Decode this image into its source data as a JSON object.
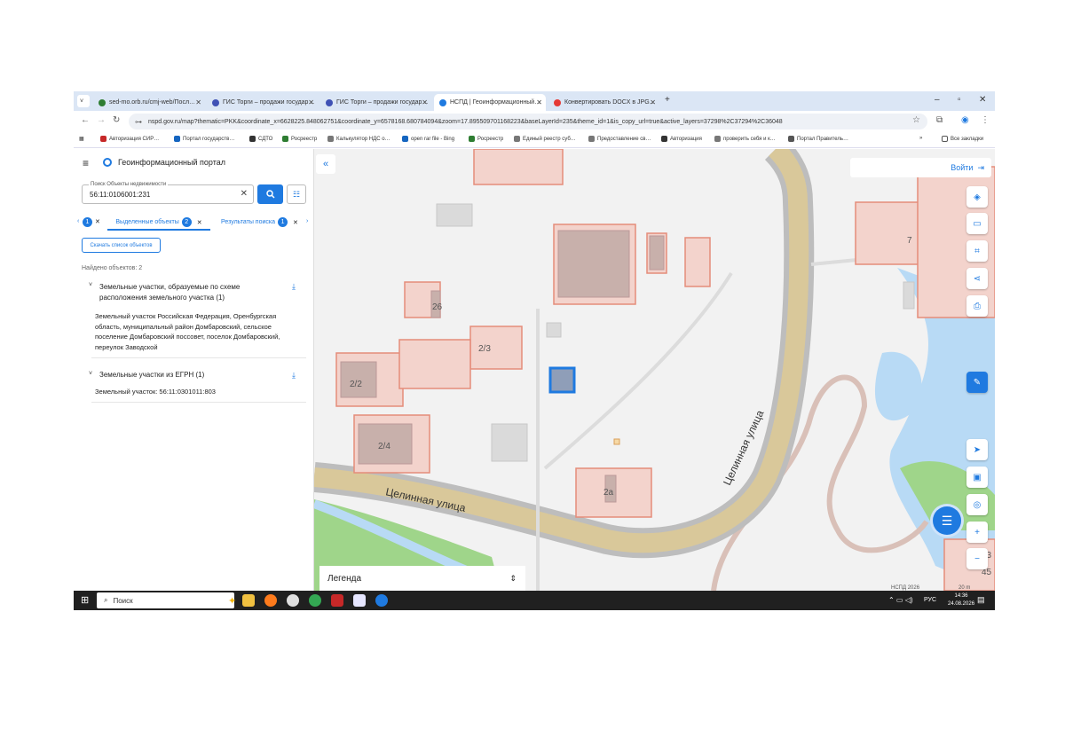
{
  "tabs": [
    {
      "label": "sed-mo.orb.ru/cmj-web/Посл…",
      "active": false
    },
    {
      "label": "ГИС Торги – продажи государ…",
      "active": false
    },
    {
      "label": "ГИС Торги – продажи государ…",
      "active": false
    },
    {
      "label": "НСПД | Геоинформационный…",
      "active": true
    },
    {
      "label": "Конвертировать DOCX в JPG…",
      "active": false
    }
  ],
  "address": {
    "url": "nspd.gov.ru/map?thematic=PKK&coordinate_x=6628225.848062751&coordinate_y=6578168.680784094&zoom=17.895509701168223&baseLayerId=235&theme_id=1&is_copy_url=true&active_layers=37298%2C37294%2C36048"
  },
  "bookmarks": [
    "Авторизация СИР…",
    "Портал государств…",
    "СДТО",
    "Росреестр",
    "Калькулятор НДС о…",
    "open rar file - Bing",
    "Росреестр",
    "Единый реестр суб…",
    "Предоставление св…",
    "Авторизация",
    "проверить себя и к…",
    "Портал Правитель…"
  ],
  "bookmarks_all": "Все закладки",
  "portal": {
    "title": "Геоинформационный портал",
    "search_label": "Поиск Объекты недвижимости",
    "search_value": "56:11:0106001:231",
    "tab_selected_label": "Выделенные объекты",
    "tab_selected_count": "2",
    "tab_results_label": "Результаты поиска",
    "tab_results_count": "1",
    "tab_prev_count": "1",
    "download_label": "Скачать список объектов",
    "found_label": "Найдено объектов: 2",
    "group1_title": "Земельные участки, образуемые по схеме расположения земельного участка (1)",
    "group1_item": "Земельный участок Российская Федерация, Оренбургская область, муниципальный район Домбаровский, сельское поселение Домбаровский поссовет, поселок Домбаровский, переулок Заводской",
    "group2_title": "Земельные участки из ЕГРН (1)",
    "group2_item": "Земельный участок: 56:11:0301011:803"
  },
  "map": {
    "login_label": "Войти",
    "legend_label": "Легенда",
    "street_label": "Целинная улица",
    "labels": [
      "26",
      "2/3",
      "2/2",
      "2/4",
      "2а",
      "7",
      "43",
      "45"
    ],
    "attribution": "НСПД 2026",
    "scale": "20 m"
  },
  "taskbar": {
    "search_placeholder": "Поиск",
    "lang": "РУС",
    "time": "14:36",
    "date": "24.08.2026"
  },
  "colors": {
    "accent": "#1f7ae0",
    "parcel": "#e58c7a",
    "road": "#d9c89a",
    "water": "#b8daf5",
    "green": "#9fd58a"
  }
}
